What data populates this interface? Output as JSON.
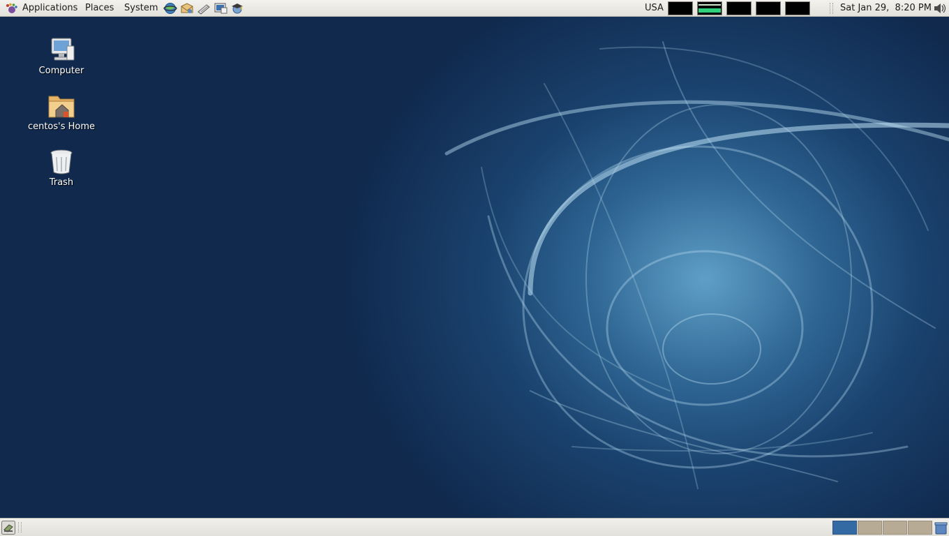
{
  "top_panel": {
    "menus": [
      "Applications",
      "Places",
      "System"
    ],
    "launchers": [
      "web-browser-icon",
      "mail-client-icon",
      "text-editor-icon",
      "terminal-icon",
      "help-icon"
    ],
    "keyboard_layout": "USA",
    "system_monitors": [
      "cpu-monitor",
      "network-monitor",
      "memory-monitor",
      "disk-monitor",
      "load-monitor"
    ],
    "clock": "Sat Jan 29,  8:20 PM",
    "volume_icon": "speaker-icon"
  },
  "desktop": {
    "icons": [
      {
        "label": "Computer",
        "icon": "computer-icon"
      },
      {
        "label": "centos's Home",
        "icon": "home-folder-icon"
      },
      {
        "label": "Trash",
        "icon": "trash-icon"
      }
    ]
  },
  "bottom_panel": {
    "show_desktop_icon": "show-desktop-icon",
    "workspaces": [
      {
        "name": "workspace-1",
        "active": true
      },
      {
        "name": "workspace-2",
        "active": false
      },
      {
        "name": "workspace-3",
        "active": false
      },
      {
        "name": "workspace-4",
        "active": false
      }
    ],
    "trash_applet_icon": "trash-applet-icon"
  },
  "colors": {
    "panel": "#e9e8e3",
    "desktop_dark": "#10294d",
    "desktop_glow": "#5f9fc6",
    "workspace_active": "#336aa3",
    "workspace_inactive": "#b7ab96"
  }
}
